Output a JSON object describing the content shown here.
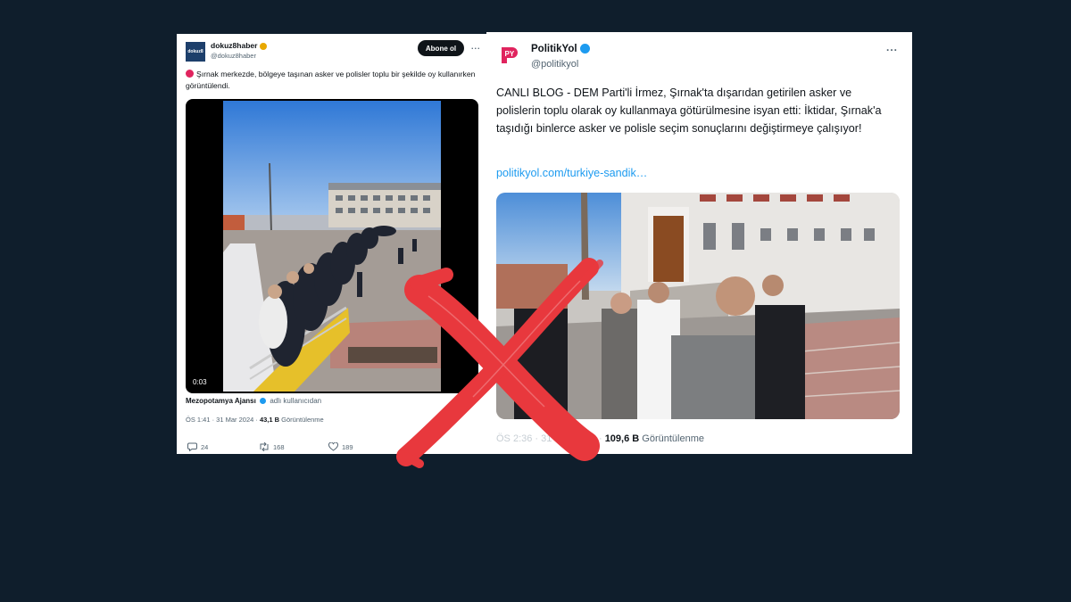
{
  "left_tweet": {
    "display_name": "dokuz8haber",
    "handle": "@dokuz8haber",
    "avatar_text": "dokuz8",
    "follow_button": "Abone ol",
    "more_icon": "...",
    "text": "Şırnak merkezde, bölgeye taşınan asker ve polisler toplu bir şekilde oy kullanırken görüntülendi.",
    "video_time": "0:03",
    "source_name": "Mezopotamya Ajansı",
    "source_suffix": "adlı kullanıcıdan",
    "timestamp": "ÖS 1:41 · 31 Mar 2024 ·",
    "views_count": "43,1 B",
    "views_label": "Görüntülenme",
    "replies": "24",
    "retweets": "168",
    "likes": "189",
    "colors": {
      "verified": "#e8a800",
      "avatar": "#1d3f6b"
    }
  },
  "right_tweet": {
    "display_name": "PolitikYol",
    "handle": "@politikyol",
    "logo_text": "PY",
    "more_icon": "...",
    "text": "CANLI BLOG - DEM Parti'li İrmez, Şırnak'ta dışarıdan getirilen asker ve polislerin toplu olarak oy kullanmaya götürülmesine isyan etti: İktidar, Şırnak'a taşıdığı binlerce asker ve polisle seçim sonuçlarını değiştirmeye çalışıyor!",
    "link": "politikyol.com/turkiye-sandik…",
    "timestamp_partial": "ÖS 2:36 · 31 Mar 2024 ·",
    "views_count": "109,6 B",
    "views_label": "Görüntülenme",
    "colors": {
      "verified": "#1d9bf0",
      "logo": "#e0245e",
      "link": "#1d9bf0"
    }
  },
  "overlay": {
    "icon": "x-mark-icon",
    "color": "#e8383d"
  },
  "background_color": "#0f1e2c"
}
